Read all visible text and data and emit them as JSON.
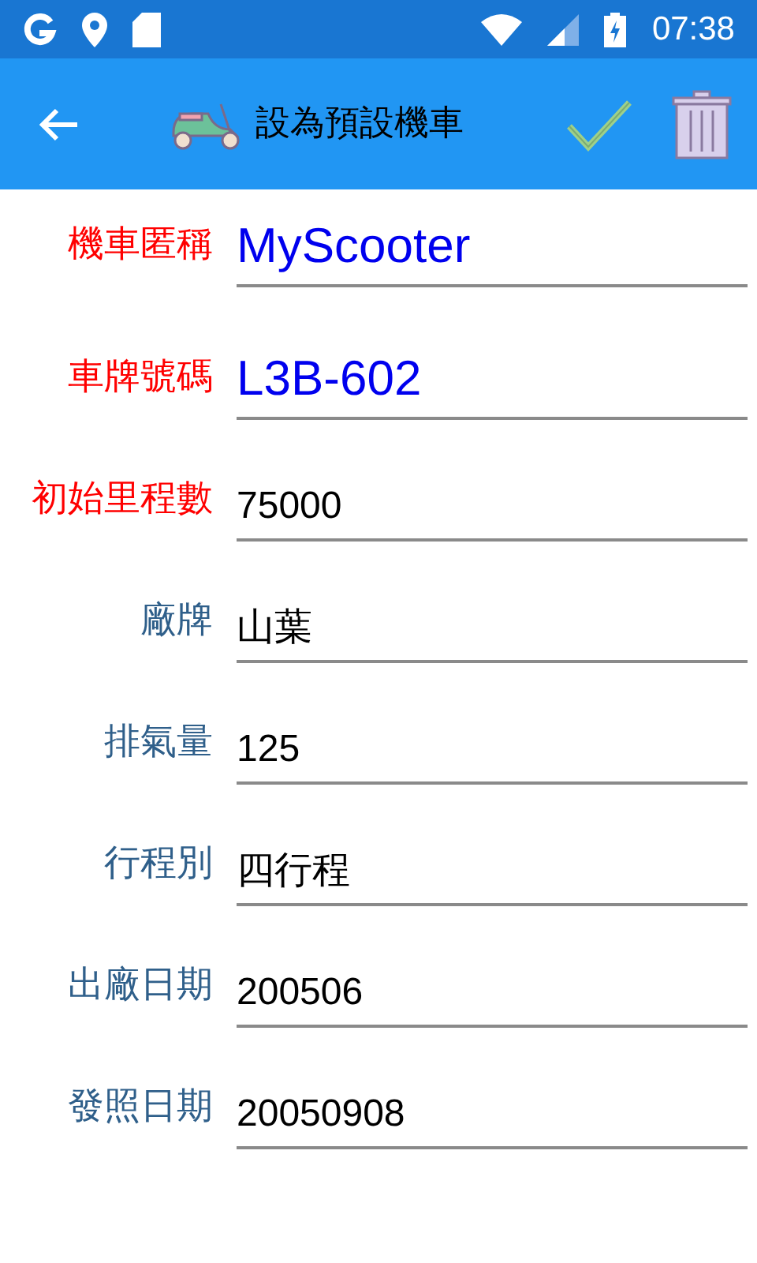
{
  "status_bar": {
    "time": "07:38"
  },
  "app_bar": {
    "title": "設為預設機車"
  },
  "fields": [
    {
      "label": "機車匿稱",
      "value": "MyScooter",
      "required": true,
      "emphasis": true
    },
    {
      "label": "車牌號碼",
      "value": "L3B-602",
      "required": true,
      "emphasis": true
    },
    {
      "label": "初始里程數",
      "value": "75000",
      "required": true,
      "emphasis": false
    },
    {
      "label": "廠牌",
      "value": "山葉",
      "required": false,
      "emphasis": false
    },
    {
      "label": "排氣量",
      "value": "125",
      "required": false,
      "emphasis": false
    },
    {
      "label": "行程別",
      "value": "四行程",
      "required": false,
      "emphasis": false
    },
    {
      "label": "出廠日期",
      "value": "200506",
      "required": false,
      "emphasis": false
    },
    {
      "label": "發照日期",
      "value": "20050908",
      "required": false,
      "emphasis": false
    }
  ]
}
